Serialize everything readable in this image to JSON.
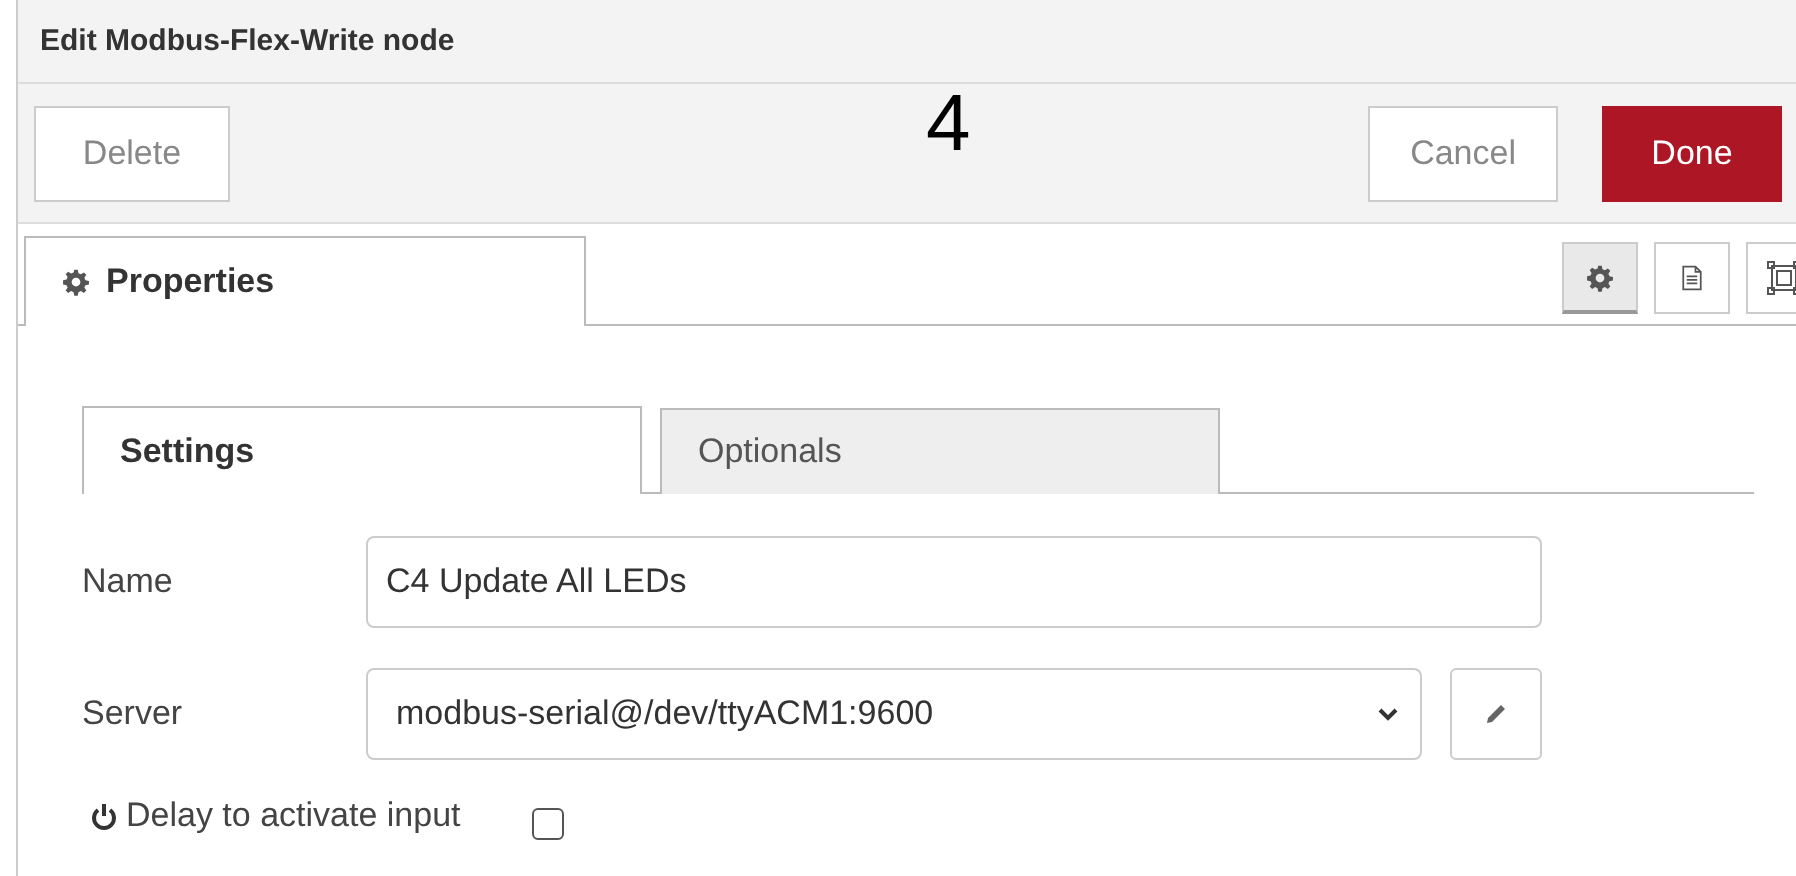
{
  "window": {
    "title": "Edit Modbus-Flex-Write node"
  },
  "annotation": "4",
  "buttons": {
    "delete": "Delete",
    "cancel": "Cancel",
    "done": "Done"
  },
  "tabs": [
    {
      "label": "Properties",
      "selected": true
    }
  ],
  "side_buttons": [
    {
      "kind": "gear",
      "selected": true
    },
    {
      "kind": "doc",
      "selected": false
    },
    {
      "kind": "frame",
      "selected": false
    }
  ],
  "subtabs": [
    {
      "label": "Settings",
      "selected": true
    },
    {
      "label": "Optionals",
      "selected": false
    }
  ],
  "fields": [
    {
      "kind": "text",
      "label": "Name",
      "value": "C4 Update All LEDs"
    },
    {
      "kind": "select",
      "label": "Server",
      "value": "modbus-serial@/dev/ttyACM1:9600"
    },
    {
      "kind": "checkbox",
      "label": "Delay to activate input",
      "checked": false
    }
  ]
}
